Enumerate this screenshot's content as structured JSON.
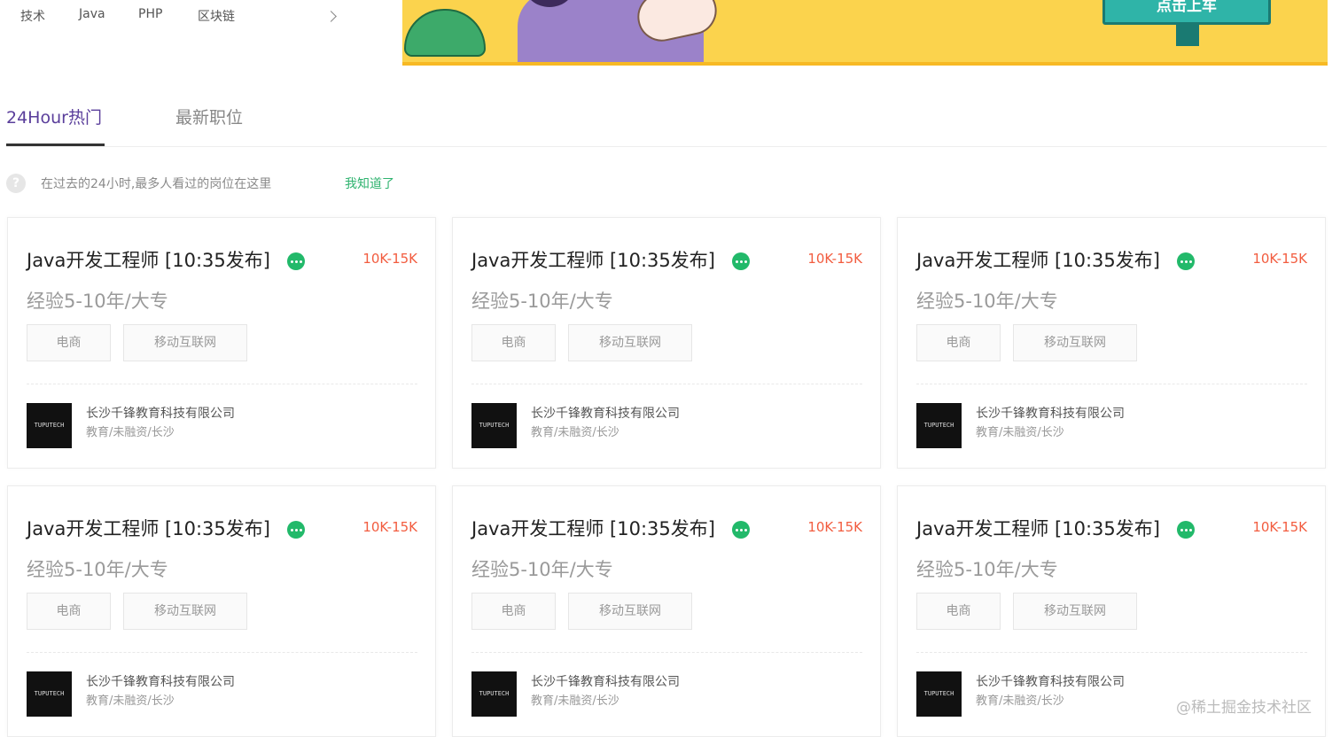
{
  "topnav": {
    "categories": [
      "技术",
      "Java",
      "PHP",
      "区块链"
    ]
  },
  "banner": {
    "sign_text": "点击上车"
  },
  "tabs": [
    {
      "label": "24Hour热门"
    },
    {
      "label": "最新职位"
    }
  ],
  "hint": {
    "icon": "?",
    "text": "在过去的24小时,最多人看过的岗位在这里",
    "link": "我知道了"
  },
  "cards": [
    {
      "title": "Java开发工程师 [10:35发布]",
      "salary": "10K-15K",
      "meta": "经验5-10年/大专",
      "tags": [
        "电商",
        "移动互联网"
      ],
      "logo": "TUPUTECH",
      "company": "长沙千锋教育科技有限公司",
      "company_info": "教育/未融资/长沙"
    },
    {
      "title": "Java开发工程师 [10:35发布]",
      "salary": "10K-15K",
      "meta": "经验5-10年/大专",
      "tags": [
        "电商",
        "移动互联网"
      ],
      "logo": "TUPUTECH",
      "company": "长沙千锋教育科技有限公司",
      "company_info": "教育/未融资/长沙"
    },
    {
      "title": "Java开发工程师 [10:35发布]",
      "salary": "10K-15K",
      "meta": "经验5-10年/大专",
      "tags": [
        "电商",
        "移动互联网"
      ],
      "logo": "TUPUTECH",
      "company": "长沙千锋教育科技有限公司",
      "company_info": "教育/未融资/长沙"
    },
    {
      "title": "Java开发工程师 [10:35发布]",
      "salary": "10K-15K",
      "meta": "经验5-10年/大专",
      "tags": [
        "电商",
        "移动互联网"
      ],
      "logo": "TUPUTECH",
      "company": "长沙千锋教育科技有限公司",
      "company_info": "教育/未融资/长沙"
    },
    {
      "title": "Java开发工程师 [10:35发布]",
      "salary": "10K-15K",
      "meta": "经验5-10年/大专",
      "tags": [
        "电商",
        "移动互联网"
      ],
      "logo": "TUPUTECH",
      "company": "长沙千锋教育科技有限公司",
      "company_info": "教育/未融资/长沙"
    },
    {
      "title": "Java开发工程师 [10:35发布]",
      "salary": "10K-15K",
      "meta": "经验5-10年/大专",
      "tags": [
        "电商",
        "移动互联网"
      ],
      "logo": "TUPUTECH",
      "company": "长沙千锋教育科技有限公司",
      "company_info": "教育/未融资/长沙"
    }
  ],
  "watermark": "@稀土掘金技术社区",
  "colors": {
    "accent": "#5a3e9b",
    "salary": "#f25c3f",
    "green": "#2fb36f",
    "banner": "#fbd34d"
  }
}
